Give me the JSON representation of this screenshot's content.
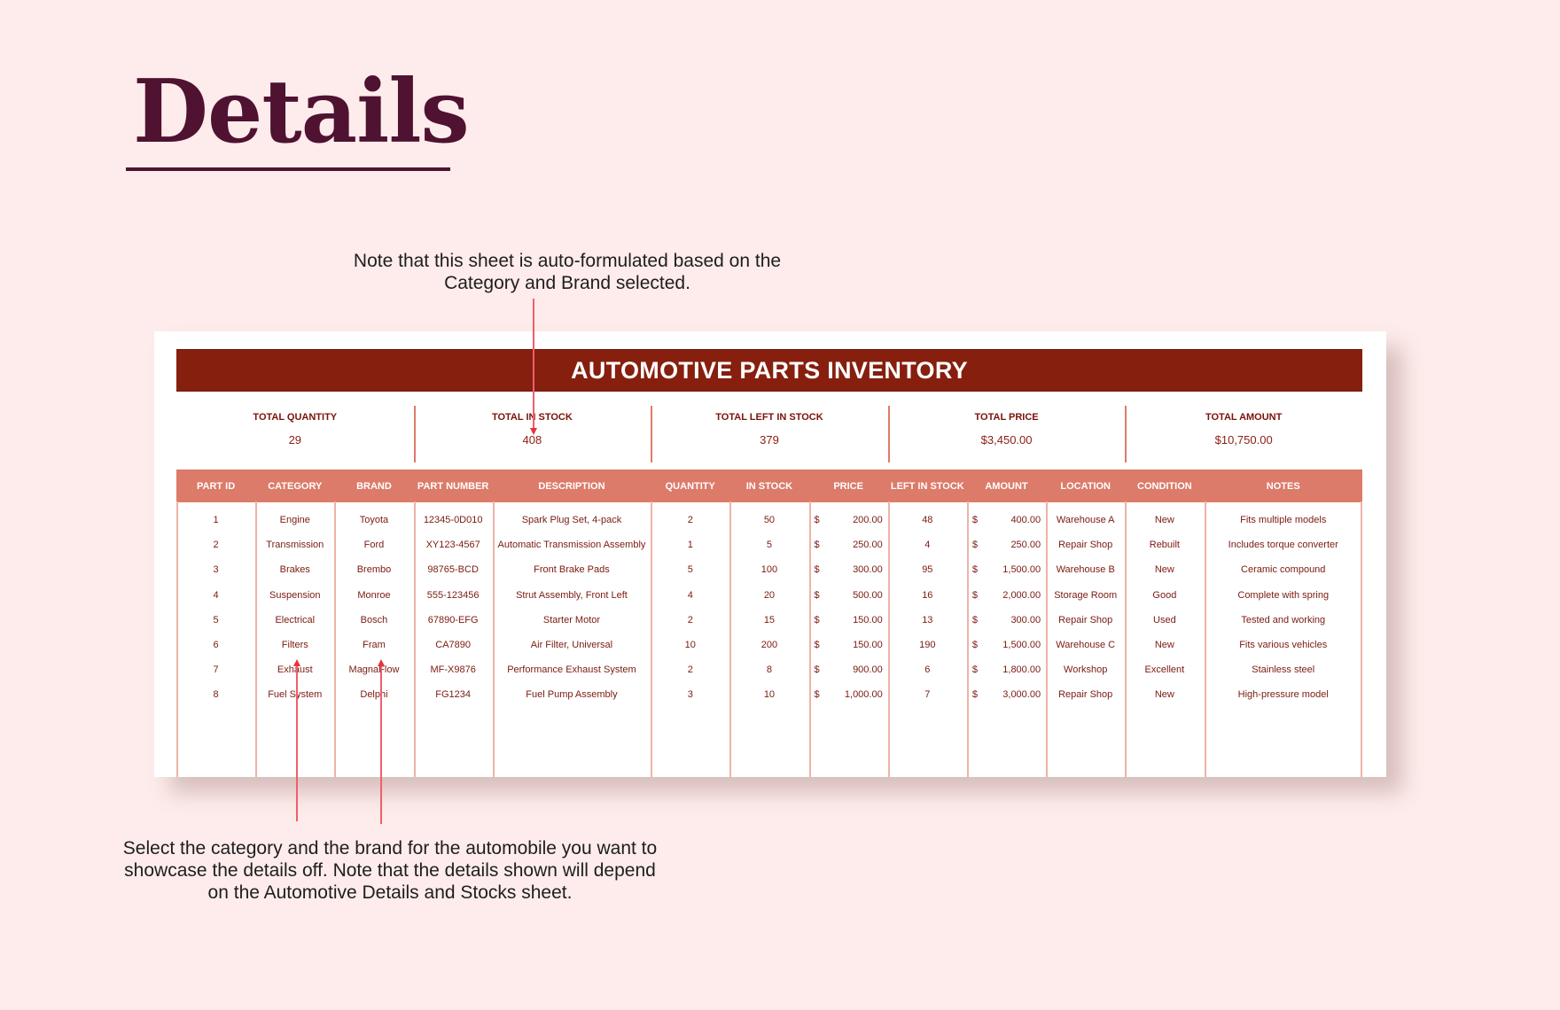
{
  "page": {
    "title": "Details"
  },
  "annotations": {
    "top_note": "Note that this sheet is auto-formulated based on the Category and Brand selected.",
    "bottom_note": "Select the category and the brand for the automobile you want to showcase the details off. Note that the details shown will depend on the Automotive Details and Stocks sheet."
  },
  "sheet": {
    "title": "AUTOMOTIVE PARTS INVENTORY",
    "colors": {
      "banner": "#861f0e",
      "header": "#dc7b6a",
      "text": "#7a1a10",
      "page_bg": "#fdeceb",
      "title": "#4f1231",
      "arrow": "#e8323c"
    },
    "summary": [
      {
        "label": "TOTAL QUANTITY",
        "value": "29"
      },
      {
        "label": "TOTAL IN STOCK",
        "value": "408"
      },
      {
        "label": "TOTAL LEFT IN STOCK",
        "value": "379"
      },
      {
        "label": "TOTAL PRICE",
        "value": "$3,450.00"
      },
      {
        "label": "TOTAL AMOUNT",
        "value": "$10,750.00"
      }
    ],
    "columns": [
      "PART ID",
      "CATEGORY",
      "BRAND",
      "PART NUMBER",
      "DESCRIPTION",
      "QUANTITY",
      "IN STOCK",
      "PRICE",
      "LEFT IN STOCK",
      "AMOUNT",
      "LOCATION",
      "CONDITION",
      "NOTES"
    ],
    "currency_symbol": "$",
    "rows": [
      {
        "part_id": "1",
        "category": "Engine",
        "brand": "Toyota",
        "part_number": "12345-0D010",
        "description": "Spark Plug Set, 4-pack",
        "quantity": "2",
        "in_stock": "50",
        "price": "200.00",
        "left_in_stock": "48",
        "amount": "400.00",
        "location": "Warehouse A",
        "condition": "New",
        "notes": "Fits multiple models"
      },
      {
        "part_id": "2",
        "category": "Transmission",
        "brand": "Ford",
        "part_number": "XY123-4567",
        "description": "Automatic Transmission Assembly",
        "quantity": "1",
        "in_stock": "5",
        "price": "250.00",
        "left_in_stock": "4",
        "amount": "250.00",
        "location": "Repair Shop",
        "condition": "Rebuilt",
        "notes": "Includes torque converter"
      },
      {
        "part_id": "3",
        "category": "Brakes",
        "brand": "Brembo",
        "part_number": "98765-BCD",
        "description": "Front Brake Pads",
        "quantity": "5",
        "in_stock": "100",
        "price": "300.00",
        "left_in_stock": "95",
        "amount": "1,500.00",
        "location": "Warehouse B",
        "condition": "New",
        "notes": "Ceramic compound"
      },
      {
        "part_id": "4",
        "category": "Suspension",
        "brand": "Monroe",
        "part_number": "555-123456",
        "description": "Strut Assembly, Front Left",
        "quantity": "4",
        "in_stock": "20",
        "price": "500.00",
        "left_in_stock": "16",
        "amount": "2,000.00",
        "location": "Storage Room",
        "condition": "Good",
        "notes": "Complete with spring"
      },
      {
        "part_id": "5",
        "category": "Electrical",
        "brand": "Bosch",
        "part_number": "67890-EFG",
        "description": "Starter Motor",
        "quantity": "2",
        "in_stock": "15",
        "price": "150.00",
        "left_in_stock": "13",
        "amount": "300.00",
        "location": "Repair Shop",
        "condition": "Used",
        "notes": "Tested and working"
      },
      {
        "part_id": "6",
        "category": "Filters",
        "brand": "Fram",
        "part_number": "CA7890",
        "description": "Air Filter, Universal",
        "quantity": "10",
        "in_stock": "200",
        "price": "150.00",
        "left_in_stock": "190",
        "amount": "1,500.00",
        "location": "Warehouse C",
        "condition": "New",
        "notes": "Fits various vehicles"
      },
      {
        "part_id": "7",
        "category": "Exhaust",
        "brand": "MagnaFlow",
        "part_number": "MF-X9876",
        "description": "Performance Exhaust System",
        "quantity": "2",
        "in_stock": "8",
        "price": "900.00",
        "left_in_stock": "6",
        "amount": "1,800.00",
        "location": "Workshop",
        "condition": "Excellent",
        "notes": "Stainless steel"
      },
      {
        "part_id": "8",
        "category": "Fuel System",
        "brand": "Delphi",
        "part_number": "FG1234",
        "description": "Fuel Pump Assembly",
        "quantity": "3",
        "in_stock": "10",
        "price": "1,000.00",
        "left_in_stock": "7",
        "amount": "3,000.00",
        "location": "Repair Shop",
        "condition": "New",
        "notes": "High-pressure model"
      }
    ]
  }
}
